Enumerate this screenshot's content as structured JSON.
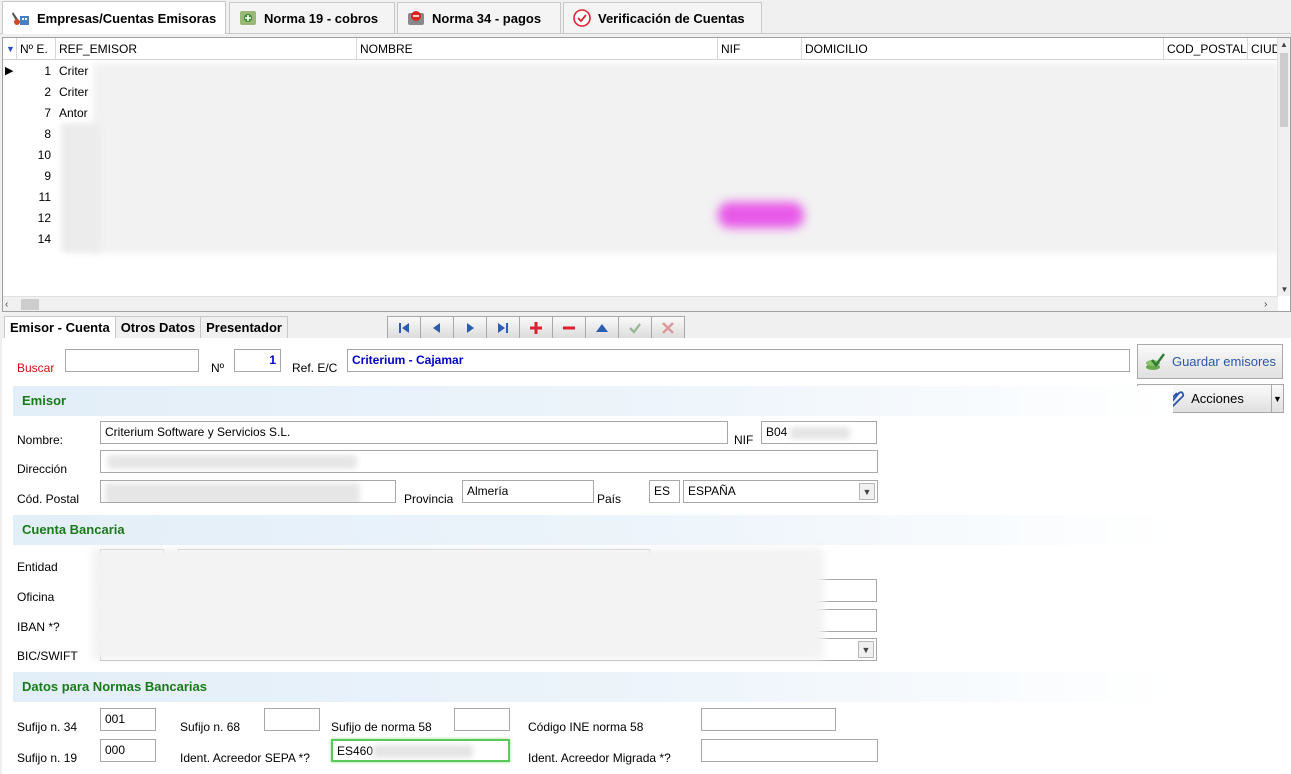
{
  "top_tabs": [
    {
      "label": "Empresas/Cuentas Emisoras",
      "icon": "company-icon"
    },
    {
      "label": "Norma 19 - cobros",
      "icon": "collect-icon"
    },
    {
      "label": "Norma 34 - pagos",
      "icon": "payment-icon"
    },
    {
      "label": "Verificación de Cuentas",
      "icon": "check-circle-icon"
    }
  ],
  "grid": {
    "headers": [
      "Nº E.",
      "REF_EMISOR",
      "NOMBRE",
      "NIF",
      "DOMICILIO",
      "COD_POSTAL",
      "CIUD"
    ],
    "rows": [
      {
        "num": "1",
        "ref": "Criter"
      },
      {
        "num": "2",
        "ref": "Criter"
      },
      {
        "num": "7",
        "ref": "Antor"
      },
      {
        "num": "8",
        "ref": ""
      },
      {
        "num": "10",
        "ref": ""
      },
      {
        "num": "9",
        "ref": ""
      },
      {
        "num": "11",
        "ref": ""
      },
      {
        "num": "12",
        "ref": ""
      },
      {
        "num": "14",
        "ref": ""
      }
    ]
  },
  "sub_tabs": [
    "Emisor - Cuenta",
    "Otros Datos",
    "Presentador"
  ],
  "form": {
    "buscar_label": "Buscar",
    "num_label": "Nº",
    "num_value": "1",
    "ref_label": "Ref. E/C",
    "ref_value": "Criterium - Cajamar",
    "save_label": "Guardar emisores",
    "actions_label": "Acciones",
    "sec_emisor": "Emisor",
    "nombre_label": "Nombre:",
    "nombre_value": "Criterium Software y Servicios S.L.",
    "nif_label": "NIF",
    "nif_value": "B04",
    "direccion_label": "Dirección",
    "cp_label": "Cód. Postal",
    "provincia_label": "Provincia",
    "provincia_value": "Almería",
    "pais_label": "País",
    "pais_code": "ES",
    "pais_value": "ESPAÑA",
    "sec_cuenta": "Cuenta Bancaria",
    "entidad_label": "Entidad",
    "oficina_label": "Oficina",
    "iban_label": "IBAN *?",
    "bic_label": "BIC/SWIFT",
    "sec_normas": "Datos para Normas Bancarias",
    "sufijo34_label": "Sufijo n. 34",
    "sufijo34_value": "001",
    "sufijo68_label": "Sufijo n. 68",
    "sufijo58_label": "Sufijo de norma 58",
    "ine58_label": "Código INE norma 58",
    "sufijo19_label": "Sufijo n. 19",
    "sufijo19_value": "000",
    "sepa_label": "Ident. Acreedor SEPA *?",
    "sepa_value": "ES460",
    "migrada_label": "Ident. Acreedor Migrada *?"
  }
}
